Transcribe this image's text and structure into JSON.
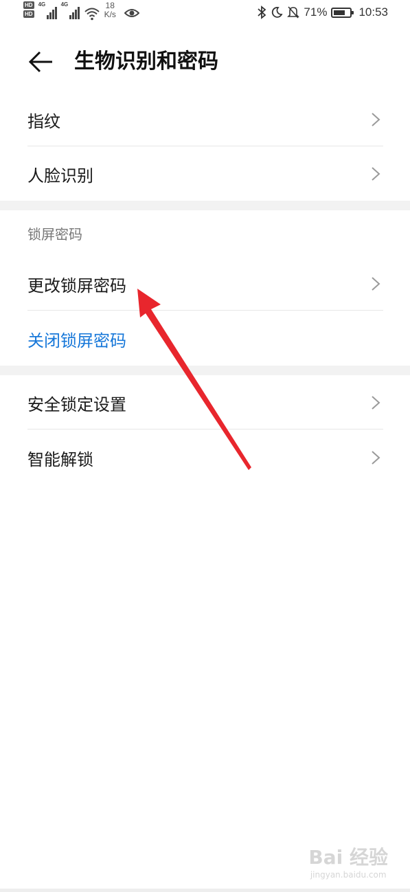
{
  "status_bar": {
    "hd1": "HD",
    "hd2": "HD",
    "net1": "4G",
    "net2": "4G",
    "speed_value": "18",
    "speed_unit": "K/s",
    "battery_percent_label": "71%",
    "battery_level": 0.71,
    "time": "10:53"
  },
  "header": {
    "title": "生物识别和密码"
  },
  "biometrics": {
    "items": [
      {
        "label": "指纹"
      },
      {
        "label": "人脸识别"
      }
    ]
  },
  "lock_screen": {
    "section_title": "锁屏密码",
    "change_label": "更改锁屏密码",
    "disable_label": "关闭锁屏密码"
  },
  "more": {
    "items": [
      {
        "label": "安全锁定设置"
      },
      {
        "label": "智能解锁"
      }
    ]
  },
  "watermark": {
    "brand": "Bai 经验",
    "url": "jingyan.baidu.com"
  },
  "colors": {
    "accent_blue": "#1677d9",
    "annotation_red": "#e8262d",
    "divider": "#e6e6e6",
    "section_gap": "#f2f2f2"
  }
}
